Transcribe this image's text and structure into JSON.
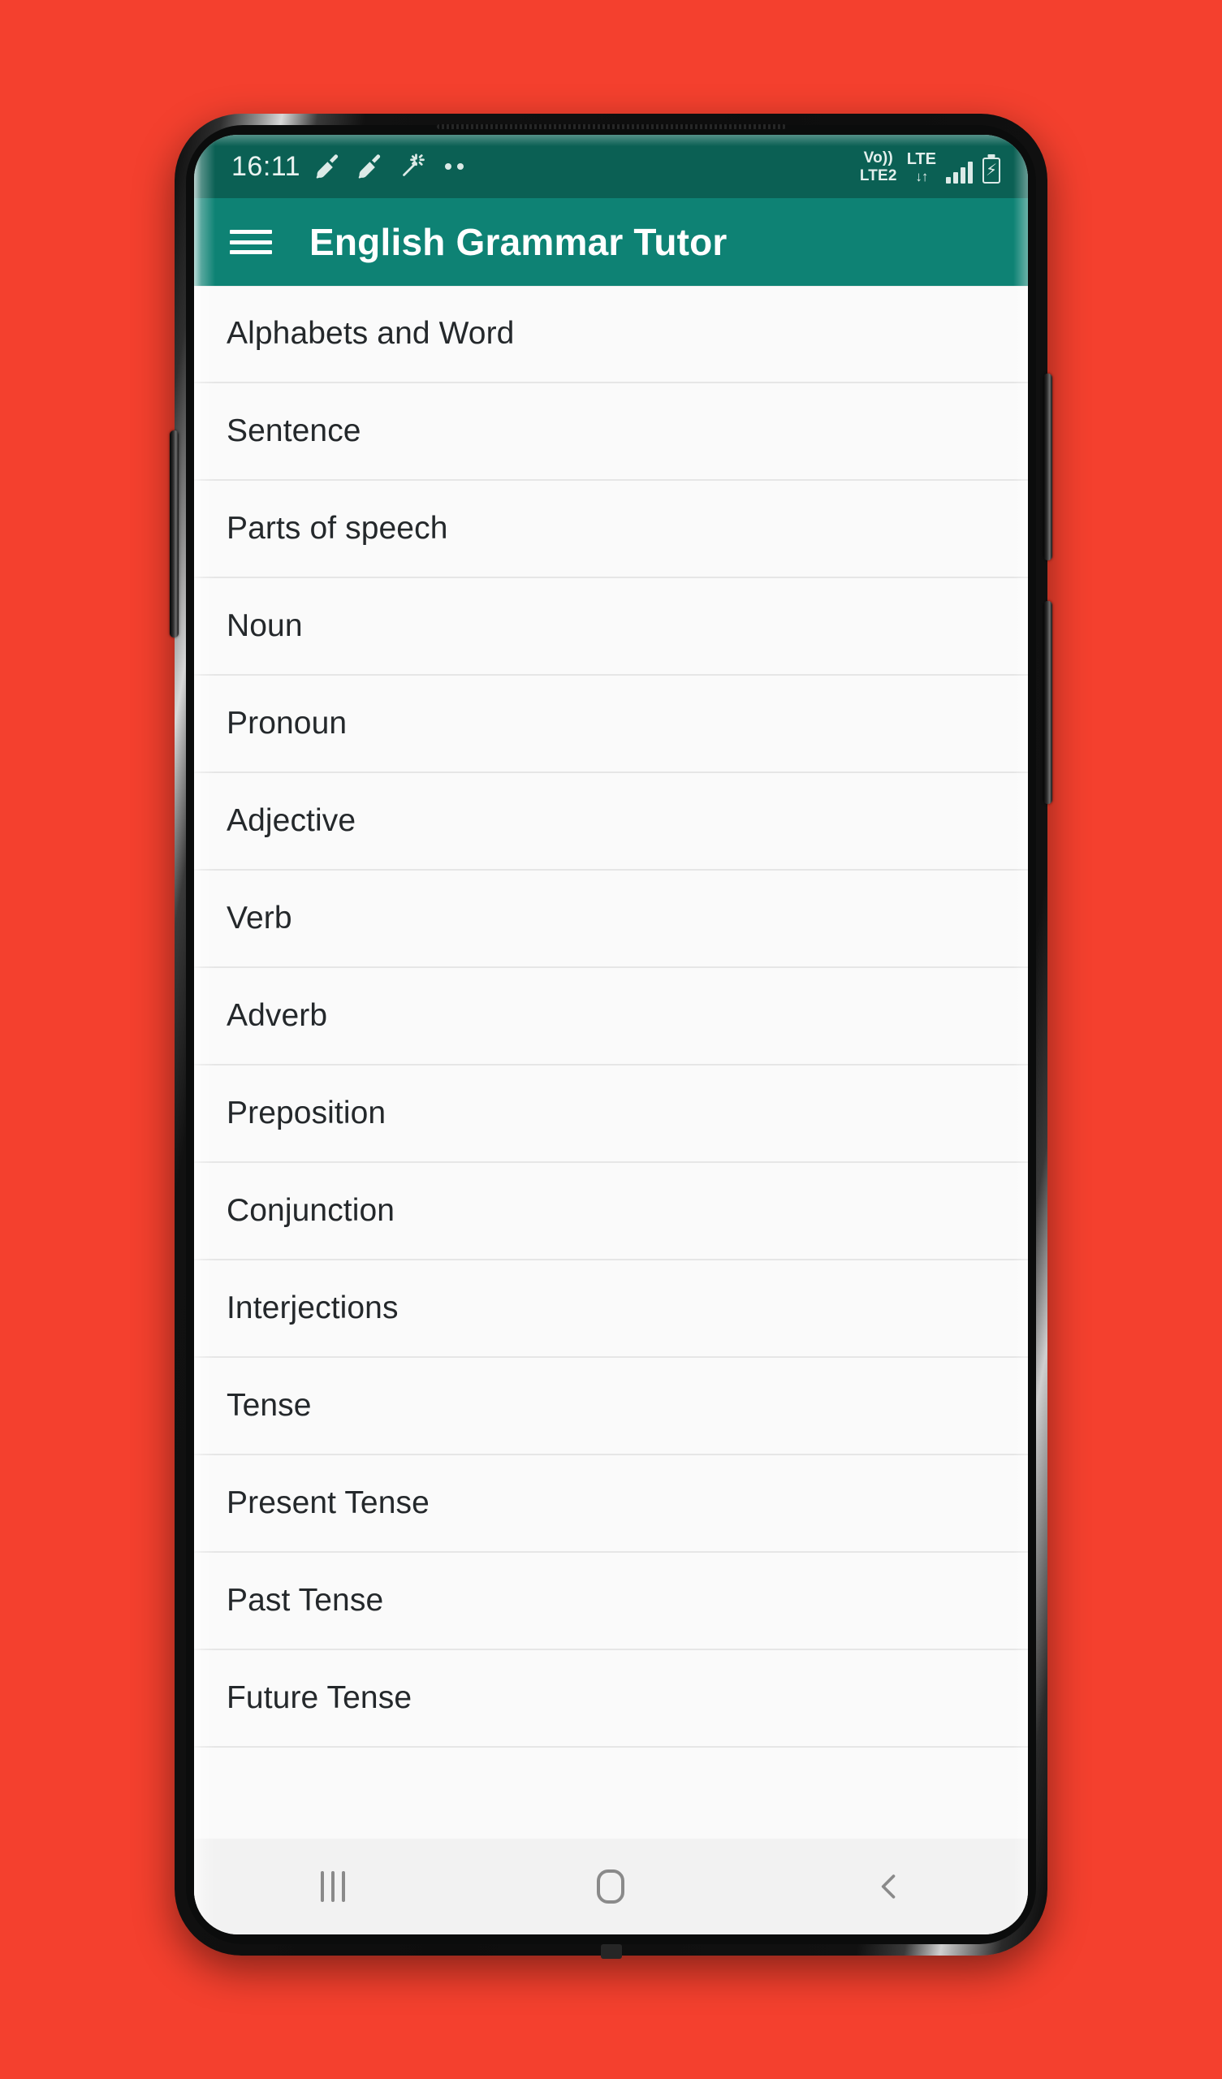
{
  "background": {
    "color": "#f4402e"
  },
  "device": {
    "frame_color": "#0b0c0c",
    "buttons": {
      "left_bixby": "bixby-button",
      "right_power": "power-button",
      "right_volume": "volume-rocker"
    }
  },
  "status_bar": {
    "background": "#0b6054",
    "time": "16:11",
    "left_icons": [
      "cleaner-broom-icon",
      "cleaner-broom-icon",
      "magic-wand-icon",
      "more-notifications-dots-icon"
    ],
    "volte": {
      "line1": "Vo))",
      "line2": "LTE2"
    },
    "network": {
      "label": "LTE",
      "arrows": "↓↑"
    },
    "signal": "signal-bars-icon",
    "battery": {
      "icon": "battery-charging-icon",
      "bolt": "⚡"
    }
  },
  "app_bar": {
    "background": "#0e8274",
    "menu_icon": "hamburger-menu-icon",
    "title": "English Grammar Tutor"
  },
  "list": {
    "items": [
      {
        "label": "Alphabets and Word"
      },
      {
        "label": "Sentence"
      },
      {
        "label": "Parts of speech"
      },
      {
        "label": "Noun"
      },
      {
        "label": "Pronoun"
      },
      {
        "label": "Adjective"
      },
      {
        "label": "Verb"
      },
      {
        "label": "Adverb"
      },
      {
        "label": "Preposition"
      },
      {
        "label": "Conjunction"
      },
      {
        "label": "Interjections"
      },
      {
        "label": "Tense"
      },
      {
        "label": "Present Tense"
      },
      {
        "label": "Past Tense"
      },
      {
        "label": "Future Tense"
      },
      {
        "label": ""
      }
    ]
  },
  "nav_bar": {
    "background": "#f2f2f2",
    "buttons": [
      {
        "name": "recents",
        "icon": "recents-icon"
      },
      {
        "name": "home",
        "icon": "home-icon"
      },
      {
        "name": "back",
        "icon": "back-chevron-icon"
      }
    ]
  }
}
